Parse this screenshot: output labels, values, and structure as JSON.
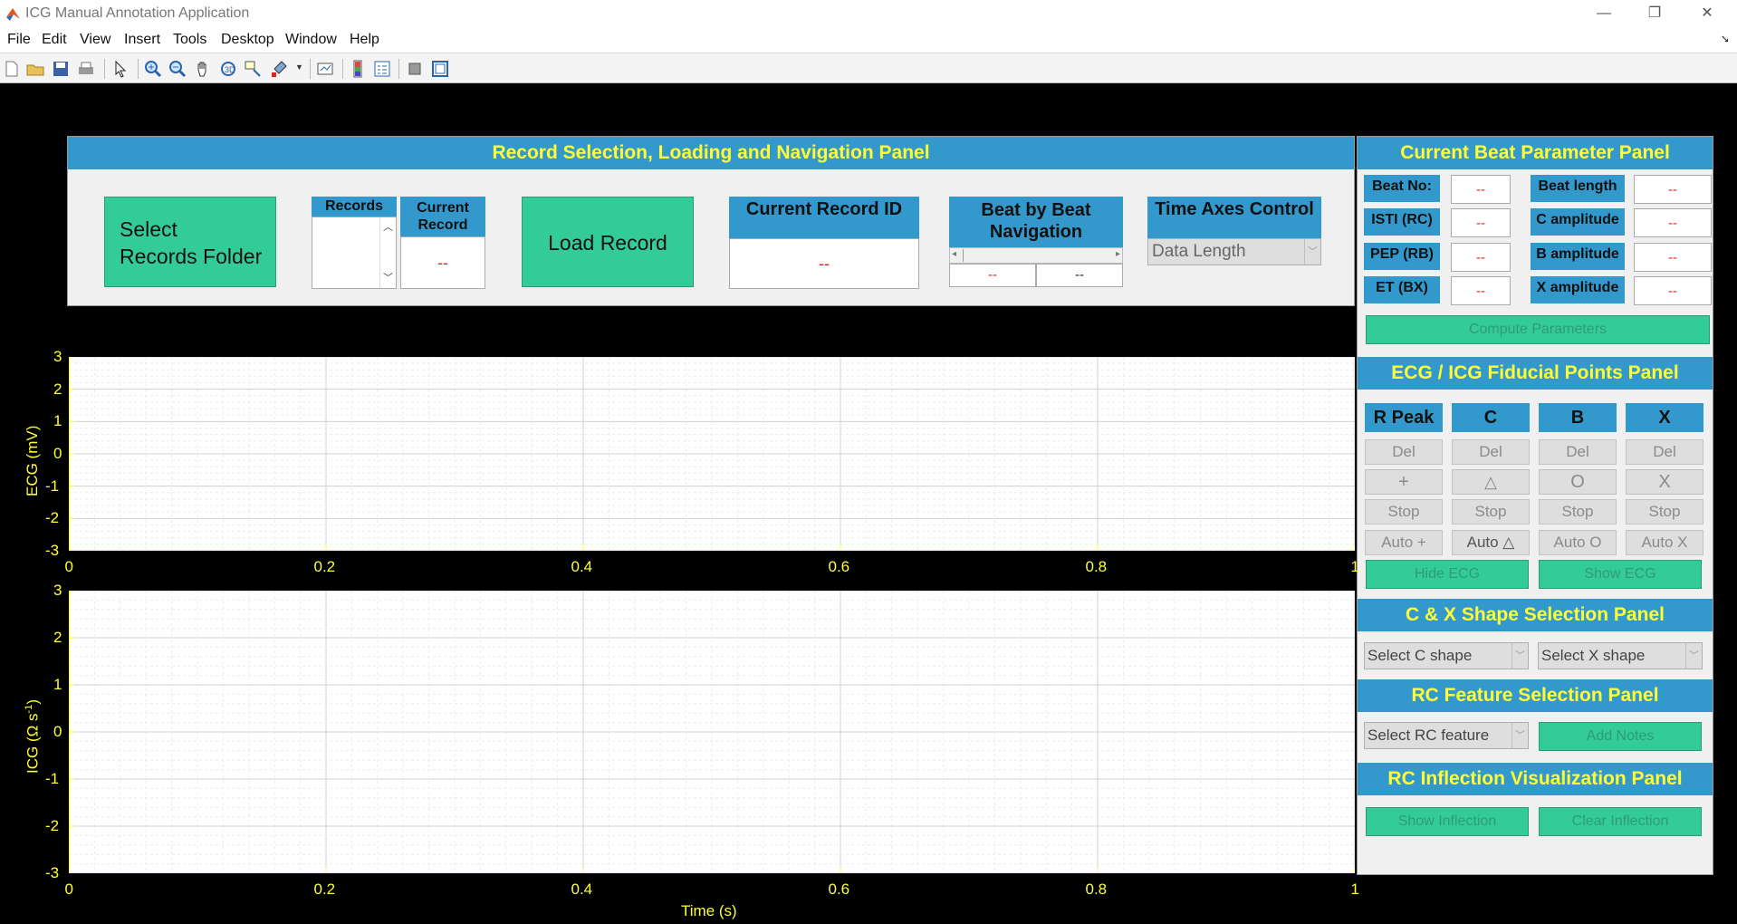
{
  "window": {
    "title": "ICG Manual Annotation Application",
    "minimize": "—",
    "restore": "❐",
    "close": "✕"
  },
  "menu": [
    "File",
    "Edit",
    "View",
    "Insert",
    "Tools",
    "Desktop",
    "Window",
    "Help"
  ],
  "toolbar_icons": [
    "new-file-icon",
    "open-folder-icon",
    "save-icon",
    "print-icon",
    "pointer-icon",
    "zoom-in-icon",
    "zoom-out-icon",
    "pan-hand-icon",
    "rotate-3d-icon",
    "data-cursor-icon",
    "brush-icon",
    "link-plot-icon",
    "colorbar-icon",
    "legend-icon",
    "hide-plot-tools-icon",
    "show-plot-tools-icon"
  ],
  "colors": {
    "panel_title_bg": "#3399cc",
    "panel_title_text": "#ffff33",
    "button_green": "#33cc99",
    "value_red": "#e52222",
    "axis_yellow": "#ffff33"
  },
  "record_panel": {
    "title": "Record Selection, Loading and Navigation Panel",
    "select_folder": [
      "Select",
      "Records Folder"
    ],
    "records_label": "Records",
    "current_record_label": [
      "Current",
      "Record"
    ],
    "current_record_value": "--",
    "load_record": "Load Record",
    "current_record_id_label": "Current Record ID",
    "current_record_id_value": "--",
    "beat_nav_label": [
      "Beat by Beat",
      "Navigation"
    ],
    "beat_nav_left": "--",
    "beat_nav_right": "--",
    "time_axes_label": "Time Axes Control",
    "time_axes_value": "Data Length"
  },
  "beat_panel": {
    "title": "Current Beat Parameter Panel",
    "rows": [
      {
        "label": "Beat No:",
        "value": "--",
        "label2": "Beat length",
        "value2": "--"
      },
      {
        "label": "ISTI (RC)",
        "value": "--",
        "label2": "C amplitude",
        "value2": "--"
      },
      {
        "label": "PEP (RB)",
        "value": "--",
        "label2": "B amplitude",
        "value2": "--"
      },
      {
        "label": "ET (BX)",
        "value": "--",
        "label2": "X amplitude",
        "value2": "--"
      }
    ],
    "compute": "Compute Parameters"
  },
  "fiducial_panel": {
    "title": "ECG / ICG Fiducial Points Panel",
    "columns": [
      {
        "header": "R Peak",
        "del": "Del",
        "mark": "+",
        "stop": "Stop",
        "auto": "Auto +"
      },
      {
        "header": "C",
        "del": "Del",
        "mark": "△",
        "stop": "Stop",
        "auto": "Auto △"
      },
      {
        "header": "B",
        "del": "Del",
        "mark": "O",
        "stop": "Stop",
        "auto": "Auto O"
      },
      {
        "header": "X",
        "del": "Del",
        "mark": "X",
        "stop": "Stop",
        "auto": "Auto X"
      }
    ],
    "hide_ecg": "Hide ECG",
    "show_ecg": "Show ECG"
  },
  "shape_panel": {
    "title": "C & X Shape Selection Panel",
    "c_shape": "Select C shape",
    "x_shape": "Select X shape"
  },
  "rc_feature_panel": {
    "title": "RC Feature Selection Panel",
    "feature": "Select RC feature",
    "add_notes": "Add Notes"
  },
  "rc_inflection_panel": {
    "title": "RC Inflection Visualization Panel",
    "show": "Show Inflection",
    "clear": "Clear Inflection"
  },
  "ecg_plot": {
    "ylabel": "ECG (mV)",
    "yticks": [
      "3",
      "2",
      "1",
      "0",
      "-1",
      "-2",
      "-3"
    ],
    "xticks": [
      "0",
      "0.2",
      "0.4",
      "0.6",
      "0.8",
      "1"
    ],
    "ylim": [
      -3,
      3
    ],
    "xlim": [
      0,
      1
    ]
  },
  "icg_plot": {
    "ylabel": "ICG (Ω s",
    "ylabel_sup": "-1",
    "ylabel_end": ")",
    "yticks": [
      "3",
      "2",
      "1",
      "0",
      "-1",
      "-2",
      "-3"
    ],
    "xticks": [
      "0",
      "0.2",
      "0.4",
      "0.6",
      "0.8",
      "1"
    ],
    "xlabel": "Time (s)",
    "ylim": [
      -3,
      3
    ],
    "xlim": [
      0,
      1
    ]
  }
}
